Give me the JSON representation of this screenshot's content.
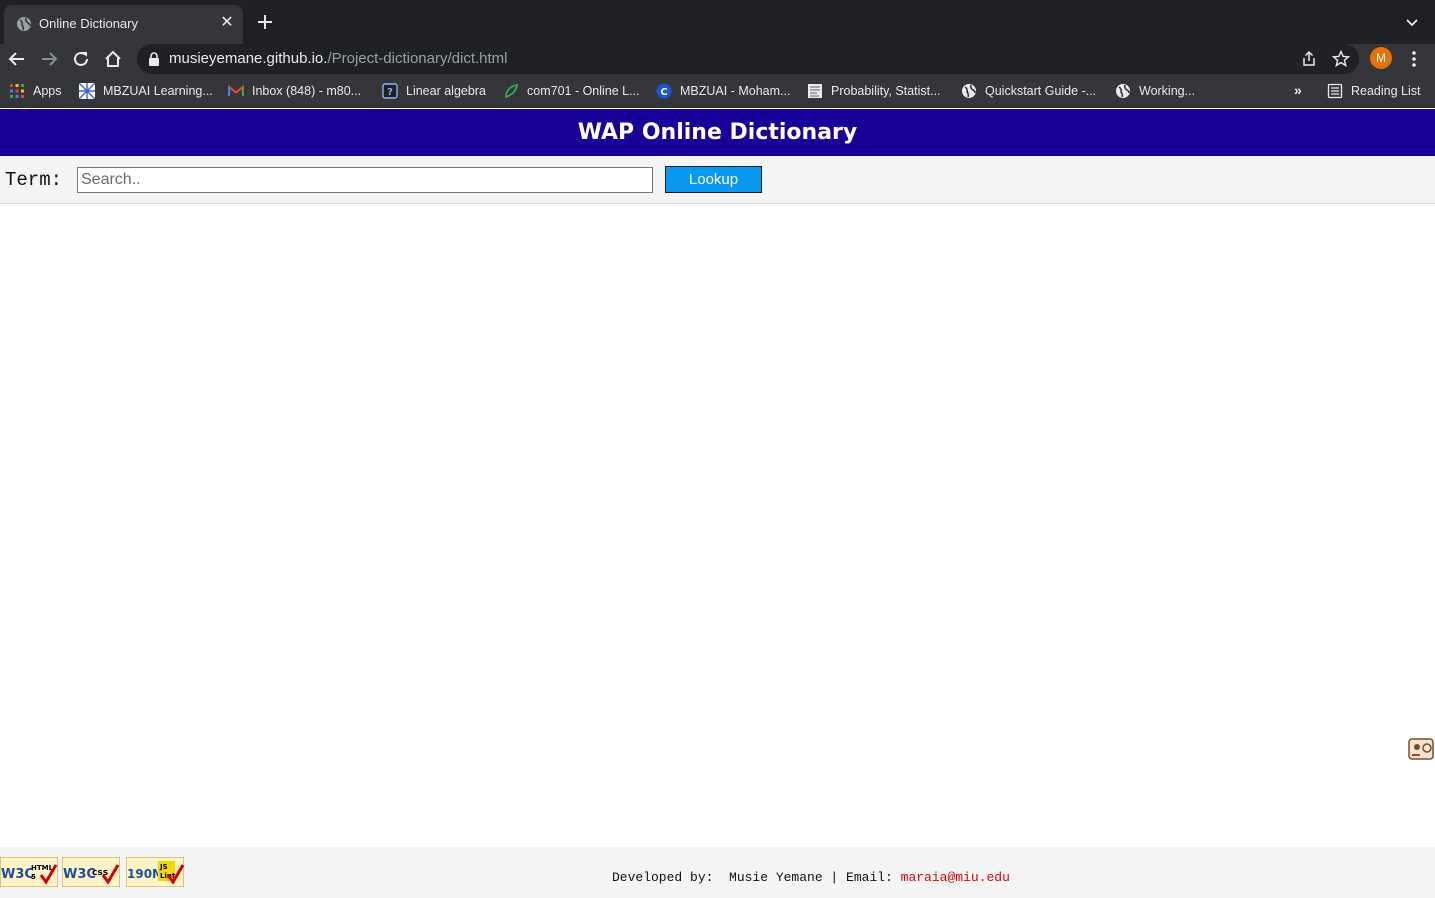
{
  "browser": {
    "tab_title": "Online Dictionary",
    "url_host": "musieyemane.github.io.",
    "url_path": "/Project-dictionary/dict.html",
    "profile_initial": "M",
    "bookmarks": [
      {
        "label": "Apps",
        "icon": "apps-grid-icon"
      },
      {
        "label": "MBZUAI Learning...",
        "icon": "mbzuai-icon"
      },
      {
        "label": "Inbox (848) - m80...",
        "icon": "gmail-icon"
      },
      {
        "label": "Linear algebra",
        "icon": "help-icon"
      },
      {
        "label": "com701 - Online L...",
        "icon": "leaf-icon"
      },
      {
        "label": "MBZUAI - Moham...",
        "icon": "c-logo-icon"
      },
      {
        "label": "Probability, Statist...",
        "icon": "document-icon"
      },
      {
        "label": "Quickstart Guide -...",
        "icon": "globe-icon"
      },
      {
        "label": "Working...",
        "icon": "globe-icon"
      }
    ],
    "more_label": "»",
    "reading_list_label": "Reading List"
  },
  "page": {
    "title": "WAP Online Dictionary",
    "term_label": "Term:",
    "search_placeholder": "Search..",
    "lookup_label": "Lookup",
    "footer": {
      "developed_by": "Developed by:  Musie Yemane | Email: ",
      "email": "maraia@miu.edu",
      "badges": [
        "W3C HTML 5",
        "W3C css",
        "JSLint"
      ]
    }
  },
  "colors": {
    "header_bg": "#1a0099",
    "button_bg": "#0a99f2",
    "email_color": "#e00000"
  }
}
